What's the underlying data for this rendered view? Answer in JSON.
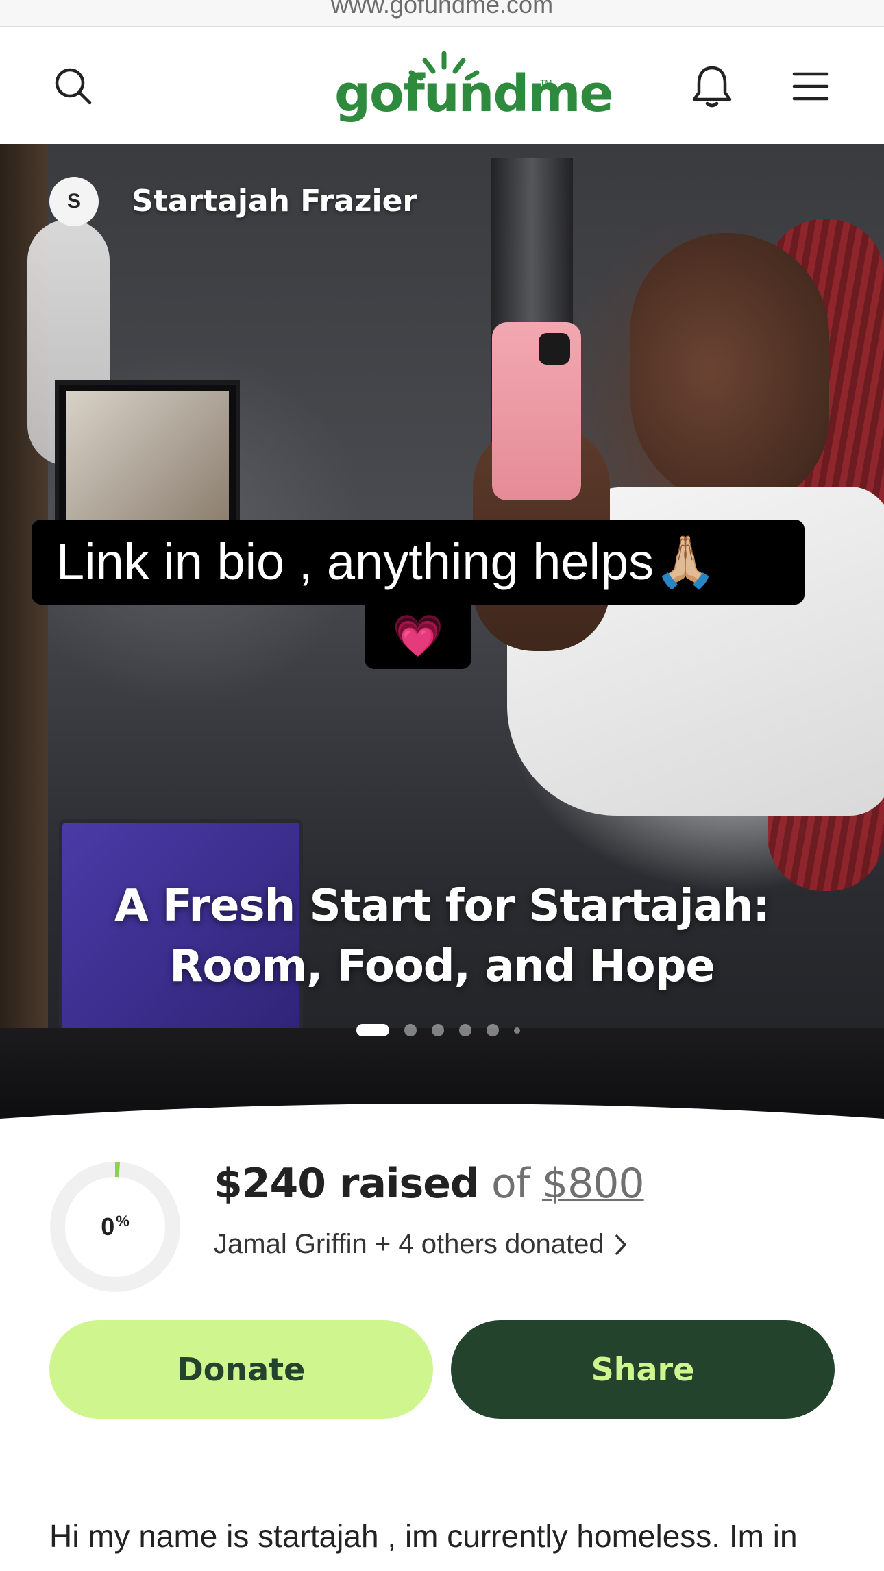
{
  "browser": {
    "url": "www.gofundme.com"
  },
  "header": {
    "logo_text": "gofundme",
    "logo_tm": "TM",
    "brand_color": "#2e8b3d",
    "icons": [
      "search-icon",
      "bell-icon",
      "menu-icon"
    ]
  },
  "hero": {
    "organizer_initial": "S",
    "organizer_name": "Startajah Frazier",
    "caption_line1": "Link in bio , anything helps🙏🏼",
    "caption_line2": "💗",
    "campaign_title_line1": "A Fresh Start for Startajah:",
    "campaign_title_line2": "Room, Food, and Hope",
    "carousel_total": 7,
    "carousel_active": 1
  },
  "progress": {
    "percent_label": "0",
    "percent_symbol": "%",
    "percent_value": 0.3,
    "raised_amount": "$240 raised",
    "of_text": "of",
    "goal_amount": "$800",
    "donors_text": "Jamal Griffin + 4 others donated",
    "ring_color": "#8fd14f"
  },
  "actions": {
    "donate_label": "Donate",
    "share_label": "Share",
    "donate_bg": "#cff58f",
    "share_bg": "#24432d"
  },
  "story": {
    "text": "Hi my name is startajah , im currently homeless. Im in need of a little help with money for a room , food"
  }
}
